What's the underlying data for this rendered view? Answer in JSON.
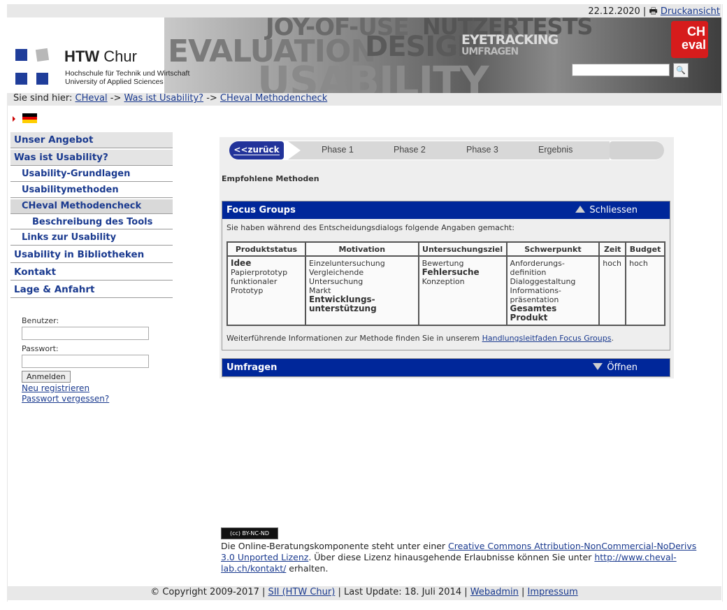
{
  "topbar": {
    "date": "22.12.2020",
    "separator": "|",
    "print_label": "Druckansicht"
  },
  "banner": {
    "brand_bold": "HTW",
    "brand_rest": " Chur",
    "brand_line1": "Hochschule für Technik und Wirtschaft",
    "brand_line2": "University of Applied Sciences",
    "words": {
      "w1": "JOY-OF-USE",
      "w2": "NUTZERTESTS",
      "w3": "EVALUATION",
      "w4": "DESIGN",
      "w5": "EYETRACKING",
      "w6": "UMFRAGEN",
      "w7": "USABILITY"
    },
    "logo_top": "CH",
    "logo_bottom": "eval"
  },
  "breadcrumb": {
    "prefix": "Sie sind hier:",
    "items": [
      "CHeval",
      "Was ist Usability?",
      "CHeval Methodencheck"
    ],
    "sep": "->"
  },
  "nav": {
    "items": [
      {
        "label": "Unser Angebot"
      },
      {
        "label": "Was ist Usability?"
      },
      {
        "label": "Usability-Grundlagen"
      },
      {
        "label": "Usabilitymethoden"
      },
      {
        "label": "CHeval Methodencheck"
      },
      {
        "label": "Beschreibung des Tools"
      },
      {
        "label": "Links zur Usability"
      },
      {
        "label": "Usability in Bibliotheken"
      },
      {
        "label": "Kontakt"
      },
      {
        "label": "Lage & Anfahrt"
      }
    ]
  },
  "login": {
    "user_label": "Benutzer:",
    "pass_label": "Passwort:",
    "submit": "Anmelden",
    "register": "Neu registrieren",
    "forgot": "Passwort vergessen?"
  },
  "steps": {
    "back": "<<zurück",
    "phases": [
      "Phase 1",
      "Phase 2",
      "Phase 3",
      "Ergebnis"
    ]
  },
  "recommended": "Empfohlene Methoden",
  "panel1": {
    "title": "Focus Groups",
    "toggle": "Schliessen",
    "intro": "Sie haben während des Entscheidungsdialogs folgende Angaben gemacht:",
    "headers": [
      "Produktstatus",
      "Motivation",
      "Untersuchungsziel",
      "Schwerpunkt",
      "Zeit",
      "Budget"
    ],
    "col_produkt": [
      "Idee",
      "Papierprototyp",
      "funktionaler",
      "Prototyp"
    ],
    "col_motivation": [
      "Einzeluntersuchung",
      "Vergleichende",
      "Untersuchung",
      "Markt",
      "Entwicklungs-",
      "unterstützung"
    ],
    "col_ziel": [
      "Bewertung",
      "Fehlersuche",
      "Konzeption"
    ],
    "col_schwer": [
      "Anforderungs-",
      "definition",
      "Dialoggestaltung",
      "Informations-",
      "präsentation",
      "Gesamtes Produkt"
    ],
    "zeit": "hoch",
    "budget": "hoch",
    "more_prefix": "Weiterführende Informationen zur Methode finden Sie in unserem ",
    "more_link": "Handlungsleitfaden Focus Groups",
    "more_suffix": "."
  },
  "panel2": {
    "title": "Umfragen",
    "toggle": "Öffnen"
  },
  "license": {
    "badge": "(cc) BY-NC-ND",
    "text1": "Die Online-Beratungskomponente steht unter einer ",
    "link1": "Creative Commons Attribution-NonCommercial-NoDerivs 3.0 Unported Lizenz",
    "text2": ". Über diese Lizenz hinausgehende Erlaubnisse können Sie unter ",
    "link2": "http://www.cheval-lab.ch/kontakt/",
    "text3": " erhalten."
  },
  "footer": {
    "copyright": "© Copyright 2009-2017 |",
    "sii": "SII (HTW Chur)",
    "update": " | Last Update: 18. Juli 2014 | ",
    "webadmin": "Webadmin",
    "sep": " | ",
    "impressum": "Impressum"
  },
  "colors": {
    "nav_blue": "#1a3a8f",
    "panel_head": "#00279a",
    "cheval_red": "#d61c1c"
  }
}
